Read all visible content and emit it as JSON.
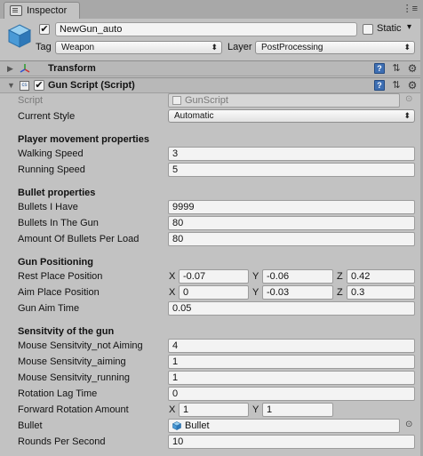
{
  "tab": {
    "label": "Inspector"
  },
  "gameobject": {
    "active_check": "✔",
    "name": "NewGun_auto",
    "static_label": "Static",
    "tag_label": "Tag",
    "tag_value": "Weapon",
    "layer_label": "Layer",
    "layer_value": "PostProcessing"
  },
  "transform": {
    "title": "Transform"
  },
  "gunscript": {
    "title": "Gun Script (Script)",
    "enabled_check": "✔",
    "script_label": "Script",
    "script_value": "GunScript",
    "style_label": "Current Style",
    "style_value": "Automatic",
    "sections": {
      "movement": "Player movement properties",
      "bullet": "Bullet properties",
      "positioning": "Gun Positioning",
      "sensitivity": "Sensitvity of the gun"
    },
    "fields": {
      "walking_label": "Walking Speed",
      "walking_value": "3",
      "running_label": "Running Speed",
      "running_value": "5",
      "bullets_have_label": "Bullets I Have",
      "bullets_have_value": "9999",
      "bullets_gun_label": "Bullets In The Gun",
      "bullets_gun_value": "80",
      "per_load_label": "Amount Of Bullets Per Load",
      "per_load_value": "80",
      "rest_label": "Rest Place Position",
      "rest_x": "-0.07",
      "rest_y": "-0.06",
      "rest_z": "0.42",
      "aim_label": "Aim Place Position",
      "aim_x": "0",
      "aim_y": "-0.03",
      "aim_z": "0.3",
      "aimtime_label": "Gun Aim Time",
      "aimtime_value": "0.05",
      "notaim_label": "Mouse Sensitvity_not Aiming",
      "notaim_value": "4",
      "aiming_label": "Mouse Sensitvity_aiming",
      "aiming_value": "1",
      "running_sens_label": "Mouse Sensitvity_running",
      "running_sens_value": "1",
      "lag_label": "Rotation Lag Time",
      "lag_value": "0",
      "fwd_label": "Forward Rotation Amount",
      "fwd_x": "1",
      "fwd_y": "1",
      "bullet_label": "Bullet",
      "bullet_value": "Bullet",
      "rps_label": "Rounds Per Second",
      "rps_value": "10"
    },
    "axes": {
      "x": "X",
      "y": "Y",
      "z": "Z"
    }
  },
  "icons": {
    "tab_menu": "⋮≡",
    "fold_open": "▼",
    "fold_closed": "▶",
    "help": "?",
    "presets": "⇅",
    "gear": "⚙",
    "dropdown_arrow": "▾",
    "updown_arrow": "⬍",
    "object_picker": "⊙"
  }
}
